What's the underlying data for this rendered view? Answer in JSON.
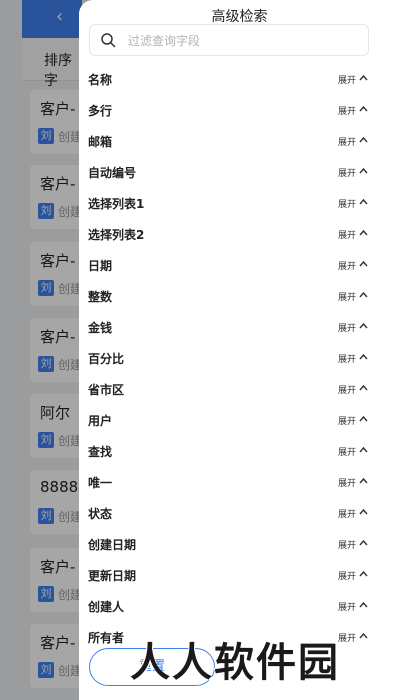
{
  "background": {
    "sort_label": "排序字",
    "cards": [
      {
        "title": "客户-",
        "avatar": "刘",
        "meta": "创建"
      },
      {
        "title": "客户-",
        "avatar": "刘",
        "meta": "创建"
      },
      {
        "title": "客户-",
        "avatar": "刘",
        "meta": "创建"
      },
      {
        "title": "客户-",
        "avatar": "刘",
        "meta": "创建"
      },
      {
        "title": "阿尔",
        "avatar": "刘",
        "meta": "创建"
      },
      {
        "title": "8888",
        "avatar": "刘",
        "meta": "创建"
      },
      {
        "title": "客户-",
        "avatar": "刘",
        "meta": "创建"
      },
      {
        "title": "客户-",
        "avatar": "刘",
        "meta": "创建"
      }
    ]
  },
  "panel": {
    "title": "高级检索",
    "search_placeholder": "过滤查询字段",
    "toggle_label": "展开",
    "fields": [
      "名称",
      "多行",
      "邮箱",
      "自动编号",
      "选择列表1",
      "选择列表2",
      "日期",
      "整数",
      "金钱",
      "百分比",
      "省市区",
      "用户",
      "查找",
      "唯一",
      "状态",
      "创建日期",
      "更新日期",
      "创建人",
      "所有者"
    ],
    "reset_label": "重置"
  },
  "watermark": "人人软件园",
  "colors": {
    "accent": "#3f82ee"
  }
}
